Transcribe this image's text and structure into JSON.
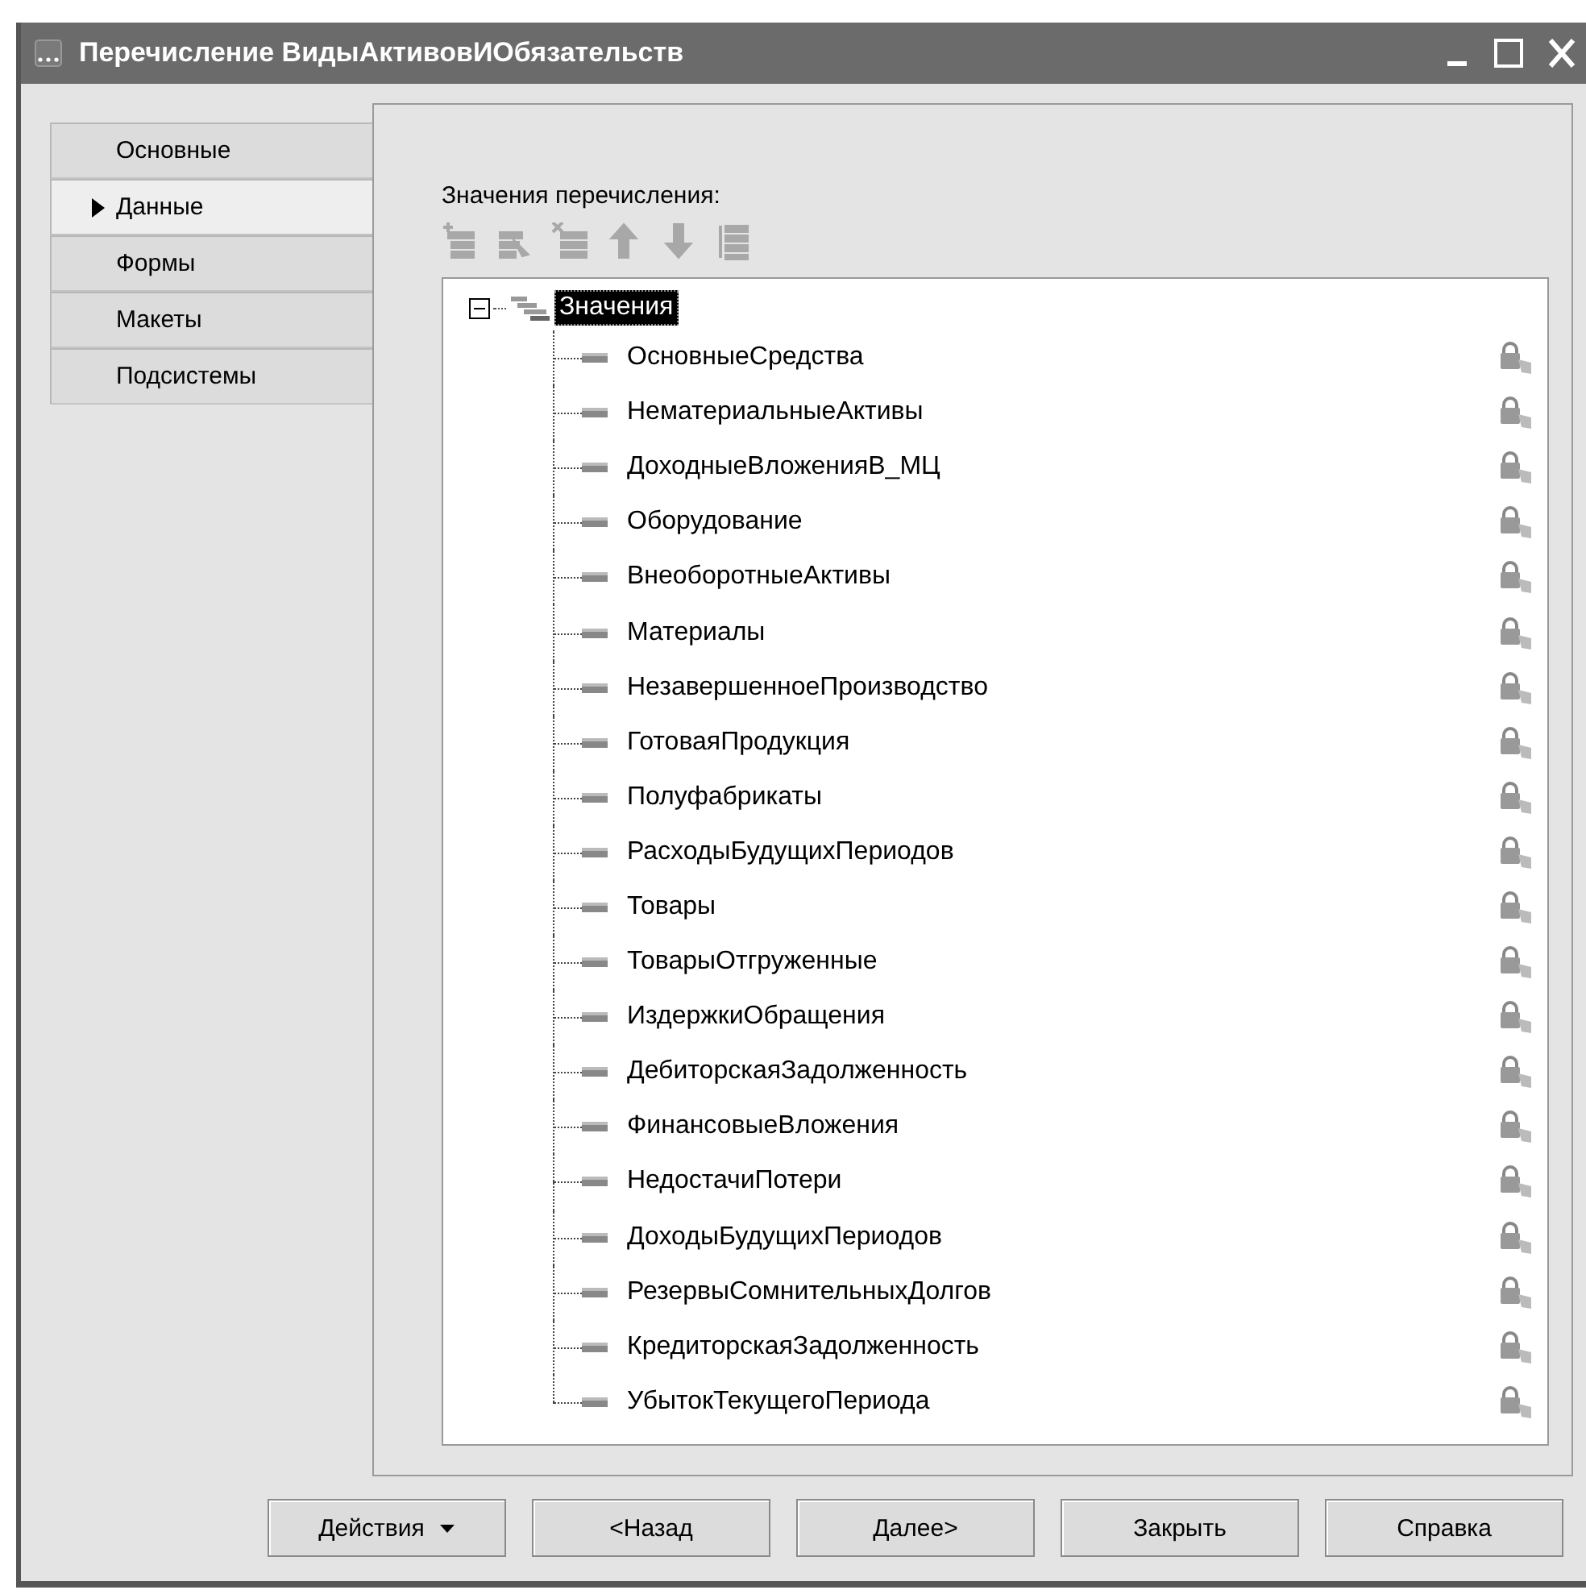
{
  "window": {
    "title": "Перечисление ВидыАктивовИОбязательств"
  },
  "tabs": [
    {
      "label": "Основные",
      "selected": false
    },
    {
      "label": "Данные",
      "selected": true
    },
    {
      "label": "Формы",
      "selected": false
    },
    {
      "label": "Макеты",
      "selected": false
    },
    {
      "label": "Подсистемы",
      "selected": false
    }
  ],
  "section_label": "Значения перечисления:",
  "toolbar": [
    {
      "kind": "add",
      "disabled": true
    },
    {
      "kind": "edit",
      "disabled": true
    },
    {
      "kind": "delete",
      "disabled": true
    },
    {
      "kind": "up",
      "disabled": true
    },
    {
      "kind": "down",
      "disabled": true
    },
    {
      "kind": "sort",
      "disabled": true
    }
  ],
  "tree": {
    "root": {
      "label": "Значения",
      "expanded": true,
      "selected": true,
      "children": [
        {
          "label": "ОсновныеСредства"
        },
        {
          "label": "НематериальныеАктивы"
        },
        {
          "label": "ДоходныеВложенияВ_МЦ"
        },
        {
          "label": "Оборудование"
        },
        {
          "label": "ВнеоборотныеАктивы"
        },
        {
          "label": "Материалы"
        },
        {
          "label": "НезавершенноеПроизводство"
        },
        {
          "label": "ГотоваяПродукция"
        },
        {
          "label": "Полуфабрикаты"
        },
        {
          "label": "РасходыБудущихПериодов"
        },
        {
          "label": "Товары"
        },
        {
          "label": "ТоварыОтгруженные"
        },
        {
          "label": "ИздержкиОбращения"
        },
        {
          "label": "ДебиторскаяЗадолженность"
        },
        {
          "label": "ФинансовыеВложения"
        },
        {
          "label": "НедостачиПотери"
        },
        {
          "label": "ДоходыБудущихПериодов"
        },
        {
          "label": "РезервыСомнительныхДолгов"
        },
        {
          "label": "КредиторскаяЗадолженность"
        },
        {
          "label": "УбытокТекущегоПериода"
        }
      ]
    }
  },
  "buttons": [
    {
      "label": "Действия",
      "kind": "dropdown"
    },
    {
      "label": "<Назад",
      "kind": "plain"
    },
    {
      "label": "Далее>",
      "kind": "plain"
    },
    {
      "label": "Закрыть",
      "kind": "plain"
    },
    {
      "label": "Справка",
      "kind": "plain"
    }
  ]
}
